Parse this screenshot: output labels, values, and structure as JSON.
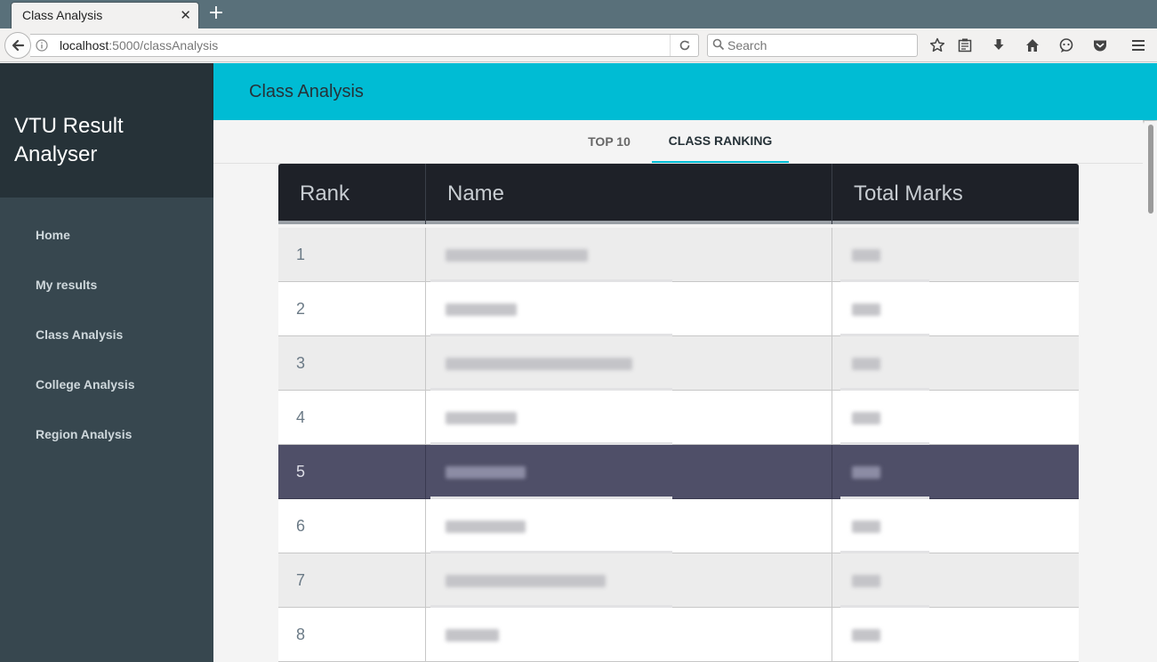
{
  "browser": {
    "tab_title": "Class Analysis",
    "url_host": "localhost",
    "url_path": ":5000/classAnalysis",
    "search_placeholder": "Search"
  },
  "sidebar": {
    "brand": "VTU Result Analyser",
    "items": [
      {
        "label": "Home"
      },
      {
        "label": "My results"
      },
      {
        "label": "Class Analysis"
      },
      {
        "label": "College Analysis"
      },
      {
        "label": "Region Analysis"
      }
    ]
  },
  "header": {
    "title": "Class Analysis"
  },
  "tabs": {
    "top10": "TOP 10",
    "class_ranking": "CLASS RANKING",
    "active": "CLASS RANKING"
  },
  "table": {
    "columns": [
      "Rank",
      "Name",
      "Total Marks"
    ],
    "rows": [
      {
        "rank": "1",
        "name": "",
        "marks": "",
        "highlighted": false
      },
      {
        "rank": "2",
        "name": "",
        "marks": "",
        "highlighted": false
      },
      {
        "rank": "3",
        "name": "",
        "marks": "",
        "highlighted": false
      },
      {
        "rank": "4",
        "name": "",
        "marks": "",
        "highlighted": false
      },
      {
        "rank": "5",
        "name": "",
        "marks": "",
        "highlighted": true
      },
      {
        "rank": "6",
        "name": "",
        "marks": "",
        "highlighted": false
      },
      {
        "rank": "7",
        "name": "",
        "marks": "",
        "highlighted": false
      },
      {
        "rank": "8",
        "name": "",
        "marks": "",
        "highlighted": false
      }
    ]
  },
  "colors": {
    "accent": "#00bcd4",
    "sidebar": "#37474f",
    "brand_bg": "#263238",
    "table_header": "#1e2128",
    "highlight_row": "#4f4f68"
  }
}
